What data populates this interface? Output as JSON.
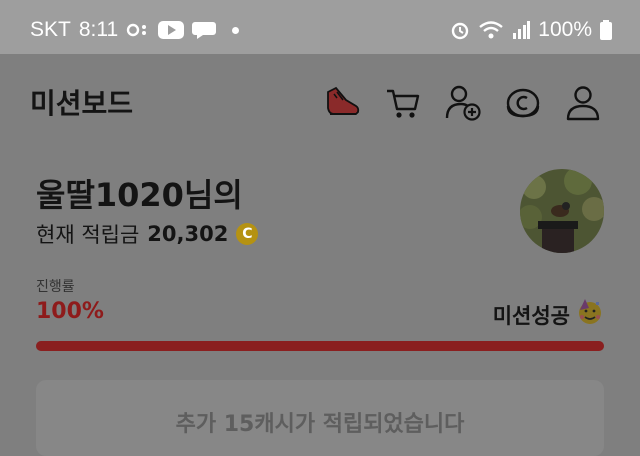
{
  "status_bar": {
    "carrier": "SKT",
    "time": "8:11",
    "battery": "100%"
  },
  "header": {
    "title": "미션보드",
    "icons": [
      "shoe-icon",
      "cart-icon",
      "add-user-icon",
      "coin-icon",
      "profile-icon"
    ]
  },
  "profile": {
    "name": "울딸1020님의",
    "balance_label": "현재 적립금",
    "balance_value": "20,302",
    "coin_symbol": "C"
  },
  "progress": {
    "label": "진행률",
    "value_text": "100%",
    "fraction": 1.0,
    "status": "미션성공"
  },
  "banner": {
    "text": "추가 15캐시가 적립되었습니다"
  },
  "colors": {
    "progress_fill": "#8a1f1f",
    "accent_red": "#8e1b1b",
    "coin": "#b59212"
  }
}
